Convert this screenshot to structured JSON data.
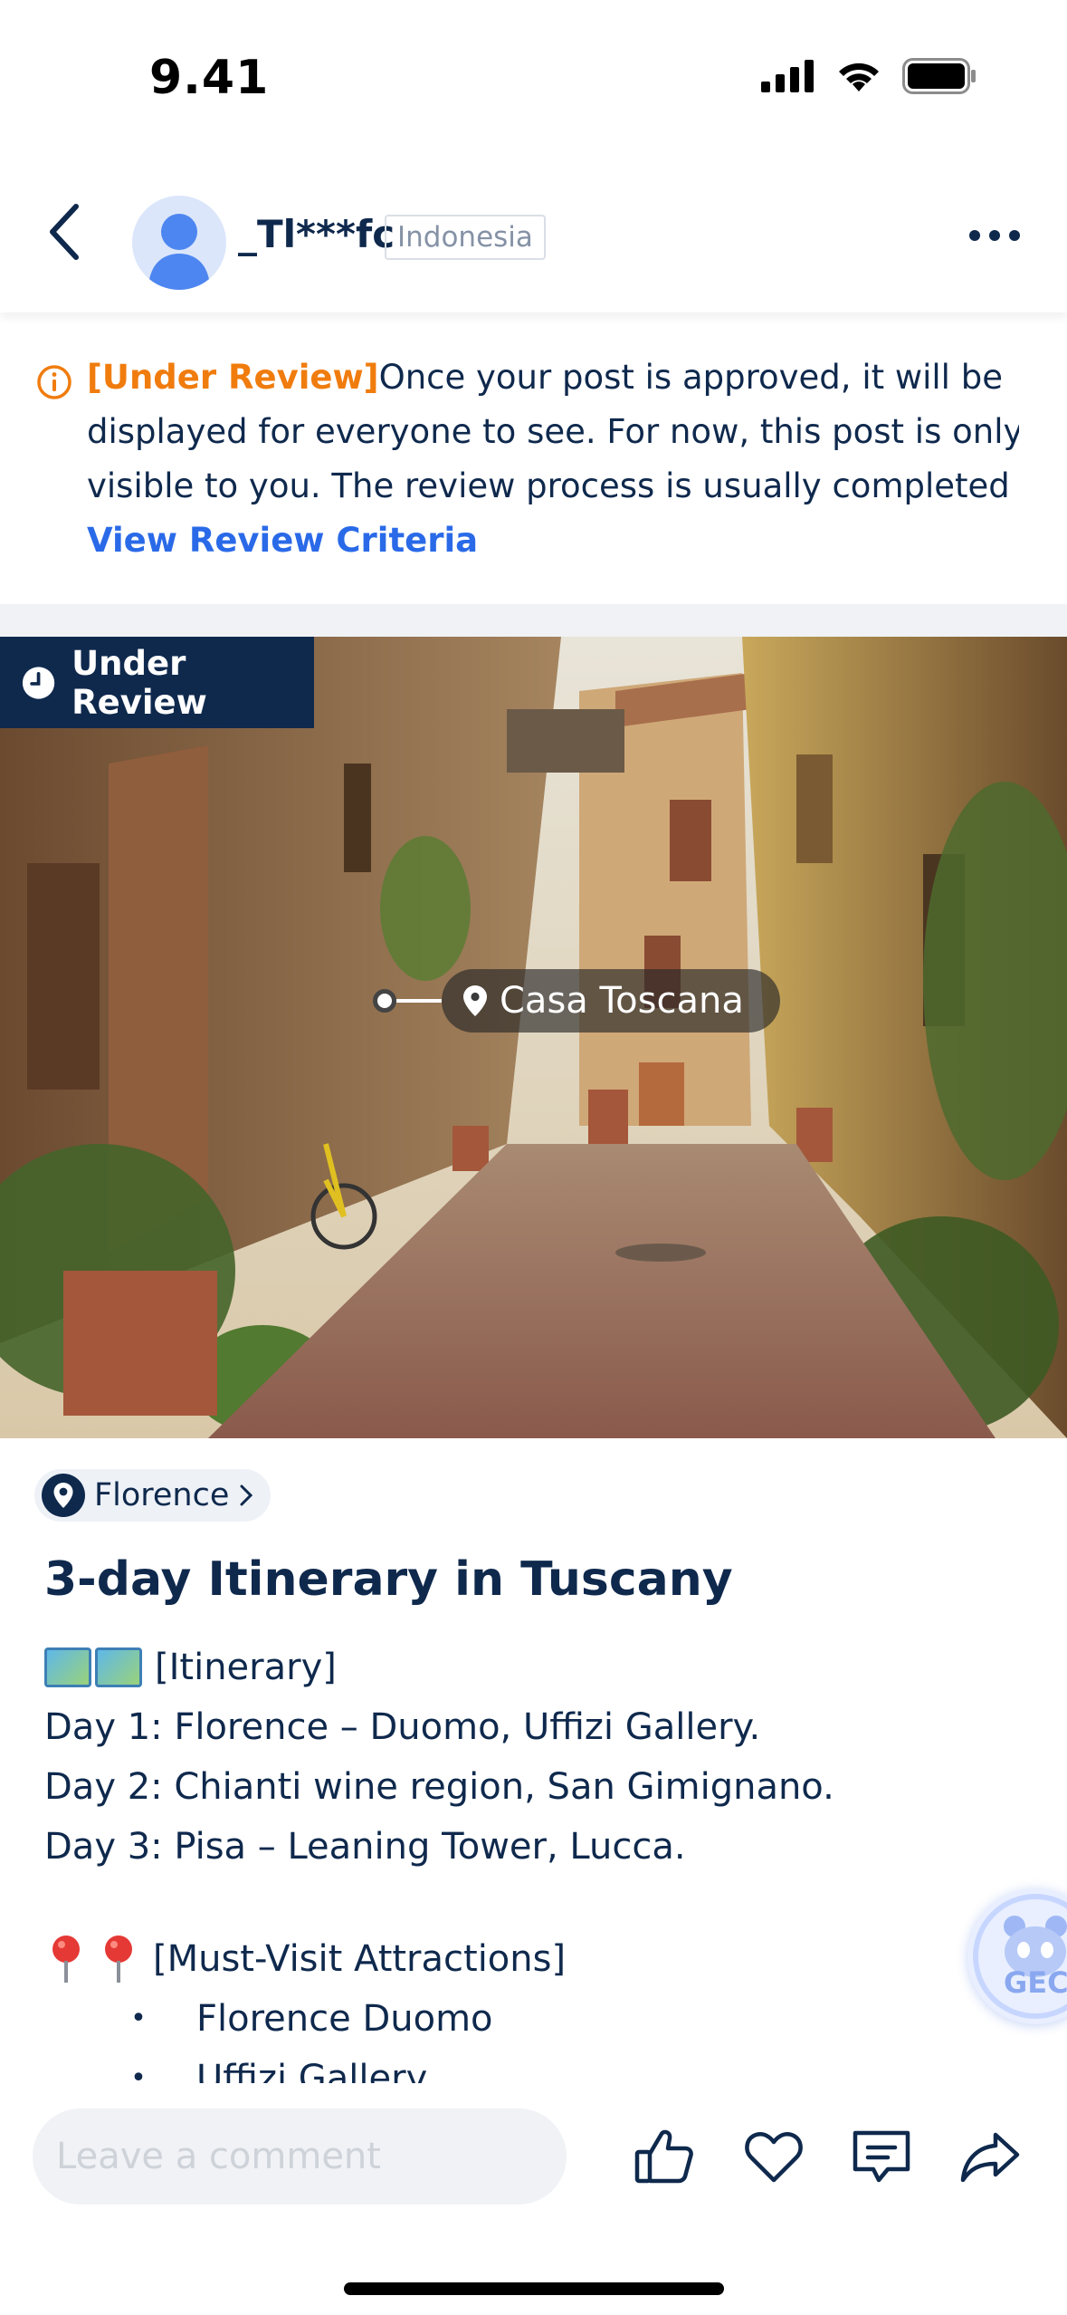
{
  "status_bar": {
    "time": "9.41",
    "icons": [
      "signal-icon",
      "wifi-icon",
      "battery-icon"
    ]
  },
  "header": {
    "username": "_Tl***fc",
    "country": "Indonesia",
    "icons": [
      "back-chevron-icon",
      "avatar-icon",
      "more-dots-icon"
    ]
  },
  "notice": {
    "tag": "[Under Review]",
    "line1": "Once your post is approved, it will be",
    "line2": "displayed for everyone to see. For now, this post is only",
    "line3": "visible to you. The review process is usually completed wit…",
    "link": "View Review Criteria",
    "accent": "#f07c0e",
    "link_color": "#2a6ae8"
  },
  "hero": {
    "badge": "Under Review",
    "location_tag": "Casa Toscana"
  },
  "post": {
    "city": "Florence",
    "title": "3-day Itinerary in Tuscany",
    "itinerary_header": "[Itinerary]",
    "days": [
      "Day 1: Florence – Duomo, Uffizi Gallery.",
      "Day 2: Chianti wine region, San Gimignano.",
      "Day 3: Pisa – Leaning Tower, Lucca."
    ],
    "attractions_header": "[Must-Visit Attractions]",
    "bullet": "•",
    "attractions": [
      "Florence Duomo",
      "Uffizi Gallery"
    ]
  },
  "floating_badge": {
    "text": "GEC"
  },
  "bottom_bar": {
    "comment_placeholder": "Leave a comment",
    "actions": [
      "like-icon",
      "favorite-icon",
      "comment-icon",
      "share-icon"
    ]
  },
  "colors": {
    "primary_text": "#0f294d",
    "badge_bg": "#0f294d",
    "divider": "#f0f2f5"
  }
}
